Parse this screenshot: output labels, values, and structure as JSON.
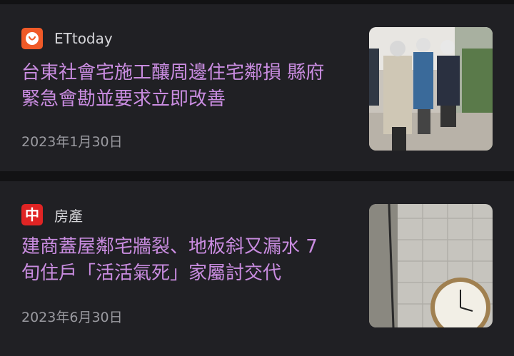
{
  "articles": [
    {
      "source": "ETtoday",
      "logo_icon": "ettoday-logo-icon",
      "logo_color": "#f05a28",
      "headline": "台東社會宅施工釀周邊住宅鄰損 縣府緊急會勘並要求立即改善",
      "date": "2023年1月30日",
      "thumbnail": "workers-inspecting-site-photo"
    },
    {
      "source": "房產",
      "logo_icon": "zhong-logo-icon",
      "logo_text": "中",
      "logo_color": "#e02424",
      "headline": "建商蓋屋鄰宅牆裂、地板斜又漏水 7旬住戶「活活氣死」家屬討交代",
      "date": "2023年6月30日",
      "thumbnail": "cracked-wall-clock-photo"
    }
  ],
  "colors": {
    "background": "#121214",
    "card": "#202024",
    "headline": "#c98ce0",
    "source": "#d6d6da",
    "date": "#9a9aa0"
  }
}
